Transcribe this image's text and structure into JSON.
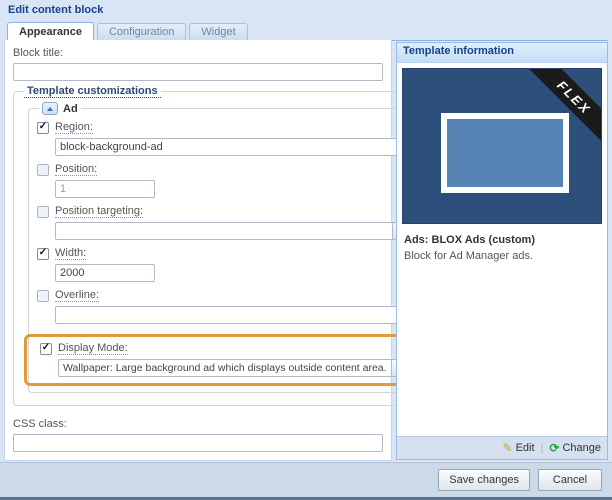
{
  "window": {
    "title": "Edit content block"
  },
  "tabs": {
    "appearance": "Appearance",
    "configuration": "Configuration",
    "widget": "Widget"
  },
  "form": {
    "block_title_label": "Block title:",
    "block_title_value": "",
    "customizations_legend": "Template customizations",
    "ad": {
      "legend": "Ad",
      "region_label": "Region:",
      "region_value": "block-background-ad",
      "position_label": "Position:",
      "position_value": "1",
      "targeting_label": "Position targeting:",
      "targeting_value": "",
      "width_label": "Width:",
      "width_value": "2000",
      "overline_label": "Overline:",
      "overline_value": "",
      "display_mode_label": "Display Mode:",
      "display_mode_value": "Wallpaper: Large background ad which displays outside content area."
    },
    "css_class_label": "CSS class:",
    "css_class_value": ""
  },
  "template_info": {
    "header": "Template information",
    "ribbon_text": "FLEX",
    "template_name": "Ads: BLOX Ads (custom)",
    "template_description": "Block for Ad Manager ads.",
    "edit_label": "Edit",
    "change_label": "Change"
  },
  "footer": {
    "save_label": "Save changes",
    "cancel_label": "Cancel"
  },
  "colors": {
    "highlight_orange": "#e09b36",
    "preview_background": "#2c4f7c",
    "preview_inner": "#5583b4",
    "accent_blue": "#15428b"
  }
}
